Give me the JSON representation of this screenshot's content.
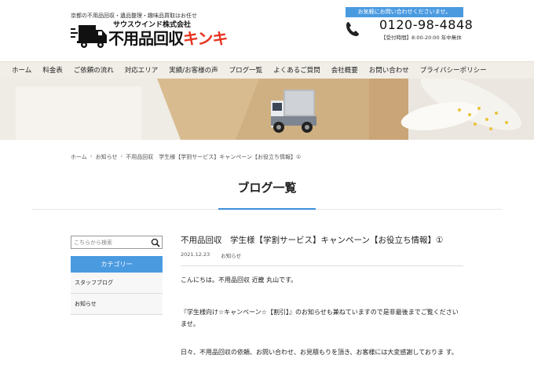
{
  "header": {
    "tagline": "京都の不用品回収・遺品整理・趣味品買取はお任せ",
    "logo": {
      "company": "サウスウインド株式会社",
      "main": "不用品回収",
      "brand": "キンキ"
    },
    "contact_banner": "お気軽にお問い合わせくださいませ。",
    "phone": "0120-98-4848",
    "hours": "【受付時間】8:00-20:00 年中無休",
    "colors": {
      "accent": "#4a9ae0",
      "brand": "#e8321e"
    }
  },
  "nav": {
    "items": [
      "ホーム",
      "料金表",
      "ご依頼の流れ",
      "対応エリア",
      "実績/お客様の声",
      "ブログ一覧",
      "よくあるご質問",
      "会社概要",
      "お問い合わせ",
      "プライバシーポリシー"
    ]
  },
  "breadcrumb": {
    "items": [
      "ホーム",
      "お知らせ",
      "不用品回収　学生様【学割サービス】キャンペーン【お役立ち情報】①"
    ]
  },
  "page": {
    "title": "ブログ一覧"
  },
  "sidebar": {
    "search_placeholder": "こちらから検索",
    "category_header": "カテゴリー",
    "categories": [
      "スタッフブログ",
      "お知らせ"
    ]
  },
  "post": {
    "title": "不用品回収　学生様【学割サービス】キャンペーン【お役立ち情報】①",
    "date": "2021.12.23",
    "category": "お知らせ",
    "paragraphs": [
      "こんにちは。不用品回収 近畿 丸山です。",
      "『学生様向け☆キャンペーン☆【割引】』のお知らせも兼ねていますので是非最後までご覧くださいませ。",
      "日々、不用品回収の依頼、お問い合わせ、お見積もりを頂き、お客様には大変感謝しておりま す。"
    ]
  }
}
